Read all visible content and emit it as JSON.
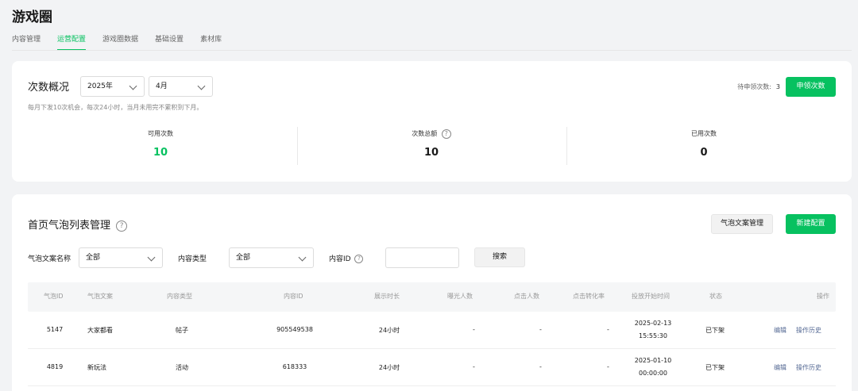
{
  "page": {
    "title": "游戏圈",
    "tabs": [
      "内容管理",
      "运营配置",
      "游戏圈数据",
      "基础设置",
      "素材库"
    ],
    "active_tab": "运营配置"
  },
  "overview": {
    "title": "次数概况",
    "year": "2025年",
    "month": "4月",
    "note": "每月下发10次机会，每次24小时，当月未用完不累积到下月。",
    "pending_label": "待申领次数:",
    "pending_value": "3",
    "claim_button": "申领次数",
    "stats": [
      {
        "label": "可用次数",
        "value": "10"
      },
      {
        "label": "次数总额",
        "value": "10"
      },
      {
        "label": "已用次数",
        "value": "0"
      }
    ],
    "accent_color": "#07c160"
  },
  "bubble": {
    "title": "首页气泡列表管理",
    "copy_manage_button": "气泡文案管理",
    "new_button": "新建配置",
    "filters": {
      "name_label": "气泡文案名称",
      "name_value": "全部",
      "type_label": "内容类型",
      "type_value": "全部",
      "id_label": "内容ID",
      "id_value": "",
      "search_button": "搜索"
    },
    "columns": [
      "气泡ID",
      "气泡文案",
      "内容类型",
      "内容ID",
      "展示时长",
      "曝光人数",
      "点击人数",
      "点击转化率",
      "投放开始时间",
      "状态",
      "操作"
    ],
    "rows": [
      {
        "id": "5147",
        "text": "大家都看",
        "type": "帖子",
        "content_id": "905549538",
        "duration": "24小时",
        "exposure": "-",
        "clicks": "-",
        "ctr": "-",
        "start_date": "2025-02-13",
        "start_time": "15:55:30",
        "status": "已下架",
        "edit": "编辑",
        "history": "操作历史"
      },
      {
        "id": "4819",
        "text": "新玩法",
        "type": "活动",
        "content_id": "618333",
        "duration": "24小时",
        "exposure": "-",
        "clicks": "-",
        "ctr": "-",
        "start_date": "2025-01-10",
        "start_time": "00:00:00",
        "status": "已下架",
        "edit": "编辑",
        "history": "操作历史"
      }
    ]
  }
}
